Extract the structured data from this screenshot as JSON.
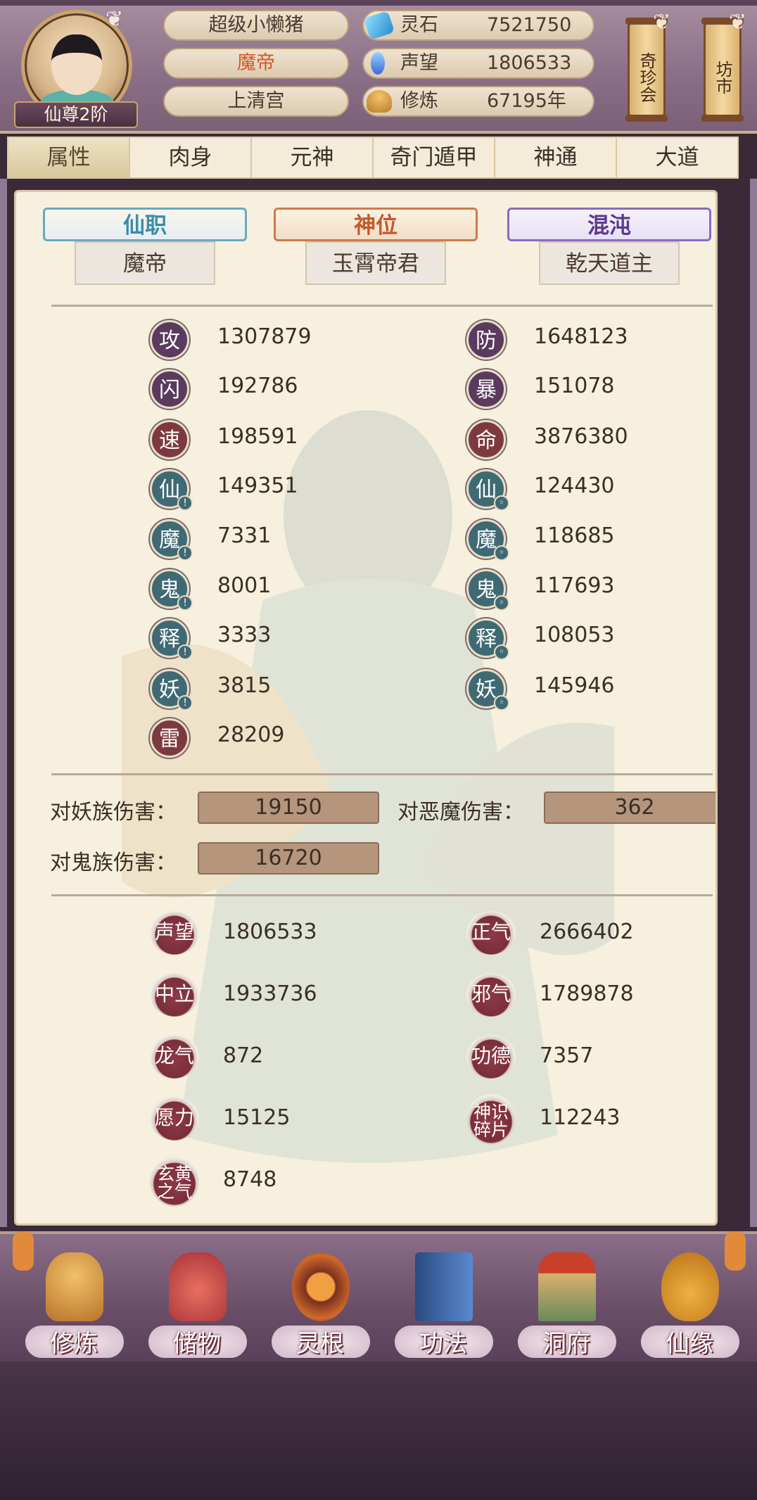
{
  "header": {
    "rank": "仙尊2阶",
    "player_name": "超级小懒猪",
    "title": "魔帝",
    "sect": "上清宫",
    "resources": [
      {
        "label": "灵石",
        "value": "7521750",
        "icon": "spirit-stone-icon",
        "color": "#3aa8d8"
      },
      {
        "label": "声望",
        "value": "1806533",
        "icon": "reputation-crystal-icon",
        "color": "#4a7ad8"
      },
      {
        "label": "修炼",
        "value": "67195年",
        "icon": "meditation-icon",
        "color": "#d8a23a"
      }
    ],
    "shop_buttons": [
      "奇珍会",
      "坊市"
    ]
  },
  "tabs": [
    "属性",
    "肉身",
    "元神",
    "奇门遁甲",
    "神通",
    "大道"
  ],
  "active_tab": "属性",
  "titles": [
    {
      "tag": "仙职",
      "value": "魔帝"
    },
    {
      "tag": "神位",
      "value": "玉霄帝君"
    },
    {
      "tag": "混沌",
      "value": "乾天道主"
    }
  ],
  "stats_left": [
    {
      "glyph": "攻",
      "value": "1307879"
    },
    {
      "glyph": "闪",
      "value": "192786"
    },
    {
      "glyph": "速",
      "value": "198591"
    },
    {
      "glyph": "仙",
      "value": "149351"
    },
    {
      "glyph": "魔",
      "value": "7331"
    },
    {
      "glyph": "鬼",
      "value": "8001"
    },
    {
      "glyph": "释",
      "value": "3333"
    },
    {
      "glyph": "妖",
      "value": "3815"
    },
    {
      "glyph": "雷",
      "value": "28209"
    }
  ],
  "stats_right": [
    {
      "glyph": "防",
      "value": "1648123"
    },
    {
      "glyph": "暴",
      "value": "151078"
    },
    {
      "glyph": "命",
      "value": "3876380"
    },
    {
      "glyph": "仙",
      "value": "124430"
    },
    {
      "glyph": "魔",
      "value": "118685"
    },
    {
      "glyph": "鬼",
      "value": "117693"
    },
    {
      "glyph": "释",
      "value": "108053"
    },
    {
      "glyph": "妖",
      "value": "145946"
    }
  ],
  "damage": [
    {
      "label": "对妖族伤害：",
      "value": "19150"
    },
    {
      "label": "对恶魔伤害：",
      "value": "362"
    },
    {
      "label": "对鬼族伤害：",
      "value": "16720"
    }
  ],
  "attributes_left": [
    {
      "label": "声望",
      "value": "1806533"
    },
    {
      "label": "中立",
      "value": "1933736"
    },
    {
      "label": "龙气",
      "value": "872"
    },
    {
      "label": "愿力",
      "value": "15125"
    },
    {
      "label": "玄黄之气",
      "value": "8748"
    }
  ],
  "attributes_right": [
    {
      "label": "正气",
      "value": "2666402"
    },
    {
      "label": "邪气",
      "value": "1789878"
    },
    {
      "label": "功德",
      "value": "7357"
    },
    {
      "label": "神识碎片",
      "value": "112243"
    }
  ],
  "bottom_nav": [
    {
      "label": "修炼",
      "icon": "monk-icon",
      "color": "#d89a3a"
    },
    {
      "label": "储物",
      "icon": "storage-bag-icon",
      "color": "#c8484a"
    },
    {
      "label": "灵根",
      "icon": "spirit-root-icon",
      "color": "#e07a2a"
    },
    {
      "label": "功法",
      "icon": "scripture-book-icon",
      "color": "#3a6aa8"
    },
    {
      "label": "洞府",
      "icon": "cave-palace-icon",
      "color": "#b8843a"
    },
    {
      "label": "仙缘",
      "icon": "gourd-icon",
      "color": "#d89a2a"
    }
  ]
}
